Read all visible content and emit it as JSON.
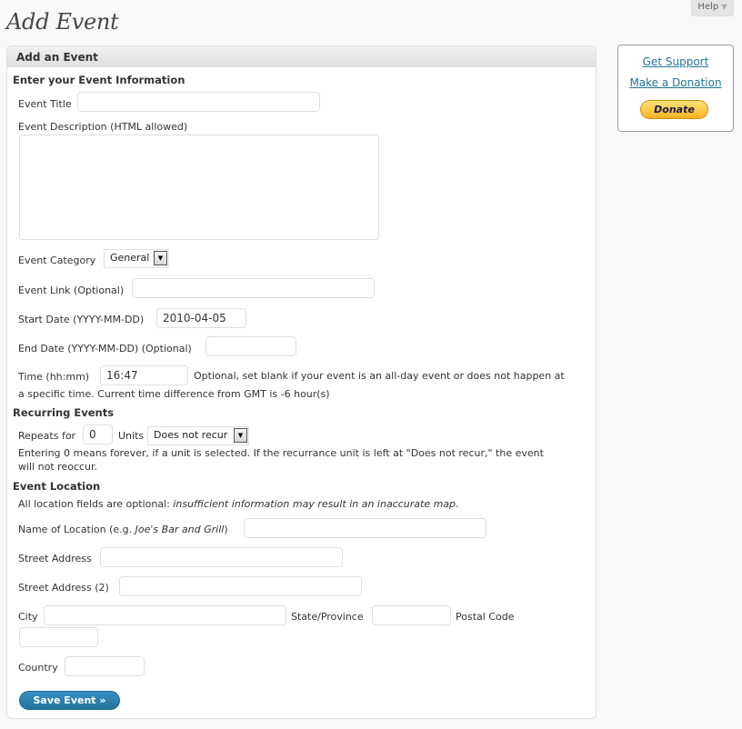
{
  "header": {
    "title": "Add Event",
    "help_label": "Help",
    "help_arrow": "▼"
  },
  "form": {
    "box_title": "Add an Event",
    "info_section": "Enter your Event Information",
    "event_title_label": "Event Title",
    "event_title_value": "",
    "description_label": "Event Description (HTML allowed)",
    "description_value": "",
    "category_label": "Event Category",
    "category_value": "General",
    "link_label": "Event Link (Optional)",
    "link_value": "",
    "start_date_label": "Start Date (YYYY-MM-DD)",
    "start_date_value": "2010-04-05",
    "end_date_label": "End Date (YYYY-MM-DD) (Optional)",
    "end_date_value": "",
    "time_label": "Time (hh:mm)",
    "time_value": "16:47",
    "time_note_1": "Optional, set blank if your event is an all-day event or does not happen at",
    "time_note_2": "a specific time. Current time difference from GMT is -6 hour(s)",
    "recurring_section": "Recurring Events",
    "repeats_label": "Repeats for",
    "repeats_value": "0",
    "units_label": "Units",
    "units_value": "Does not recur",
    "recur_note_1": "Entering 0 means forever, if a unit is selected. If the recurrance unit is left at \"Does not recur,\" the event",
    "recur_note_2": "will not reoccur.",
    "location_section": "Event Location",
    "location_note_plain": "All location fields are optional: ",
    "location_note_italic": "insufficient information may result in an inaccurate map",
    "location_note_end": ".",
    "location_name_label_a": "Name of Location (e.g. ",
    "location_name_label_italic": "Joe's Bar and Grill",
    "location_name_label_b": ")",
    "location_name_value": "",
    "street_label": "Street Address",
    "street_value": "",
    "street2_label": "Street Address (2)",
    "street2_value": "",
    "city_label": "City",
    "city_value": "",
    "state_label": "State/Province",
    "state_value": "",
    "postal_label": "Postal Code",
    "postal_value": "",
    "country_label": "Country",
    "country_value": "",
    "save_label": "Save Event »"
  },
  "sidebar": {
    "support_link": "Get Support",
    "donation_link": "Make a Donation",
    "donate_button": "Donate"
  },
  "colors": {
    "link": "#21759b",
    "save_button": "#21759b",
    "donate_button": "#f9b421"
  }
}
